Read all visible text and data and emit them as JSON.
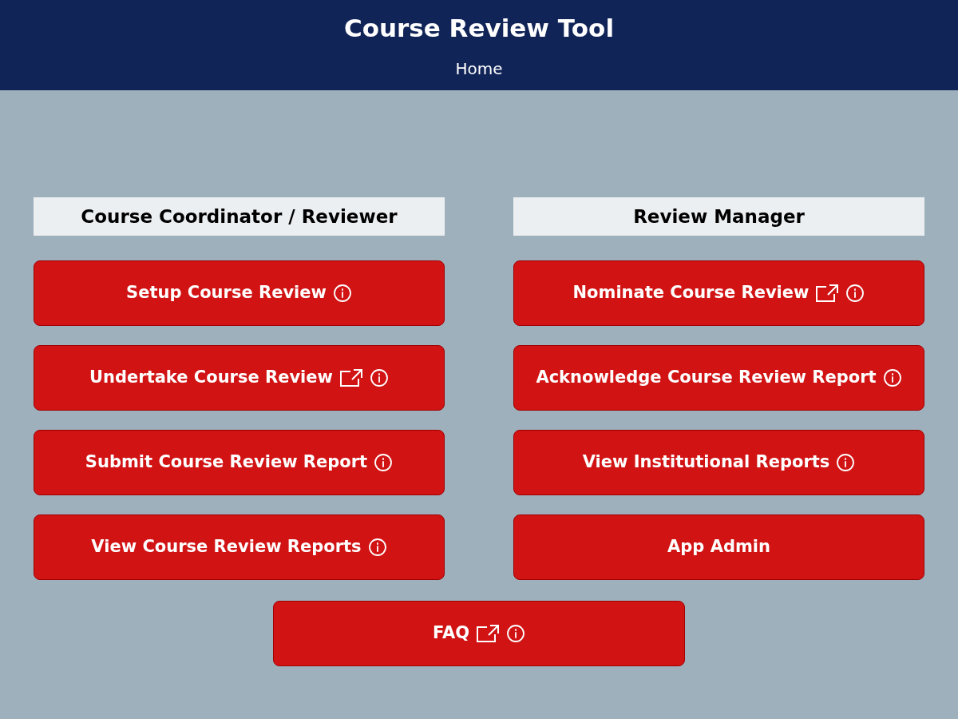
{
  "header": {
    "title": "Course Review Tool",
    "breadcrumb": "Home"
  },
  "columns": [
    {
      "heading": "Course Coordinator / Reviewer",
      "buttons": [
        {
          "label": "Setup Course Review",
          "external": false,
          "info": true
        },
        {
          "label": "Undertake Course Review",
          "external": true,
          "info": true
        },
        {
          "label": "Submit Course Review Report",
          "external": false,
          "info": true
        },
        {
          "label": "View Course Review Reports",
          "external": false,
          "info": true
        }
      ]
    },
    {
      "heading": "Review Manager",
      "buttons": [
        {
          "label": "Nominate Course Review",
          "external": true,
          "info": true
        },
        {
          "label": "Acknowledge Course Review Report",
          "external": false,
          "info": true
        },
        {
          "label": "View Institutional Reports",
          "external": false,
          "info": true
        },
        {
          "label": "App Admin",
          "external": false,
          "info": false
        }
      ]
    }
  ],
  "footer_button": {
    "label": "FAQ",
    "external": true,
    "info": true
  }
}
